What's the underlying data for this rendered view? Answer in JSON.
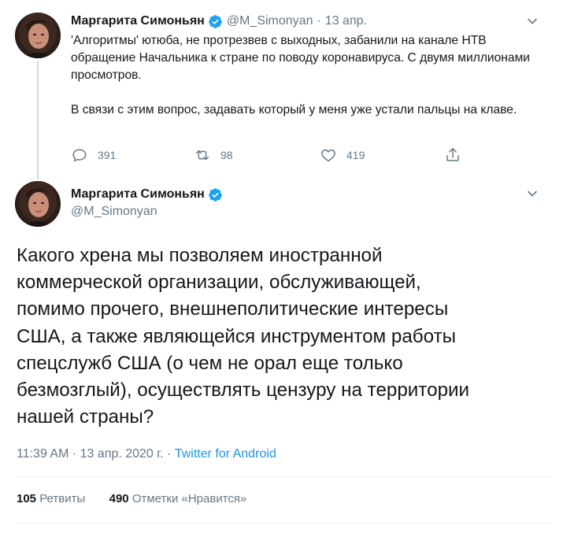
{
  "tweet1": {
    "name": "Маргарита Симоньян",
    "handle": "@M_Simonyan",
    "separator": "·",
    "date": "13 апр.",
    "paragraph1": "'Алгоритмы' ютюба, не протрезвев с выходных, забанили на канале НТВ обращение Начальника к стране по поводу коронавируса. С двумя миллионами просмотров.",
    "paragraph2": "В связи с этим вопрос, задавать который у меня уже устали пальцы на клаве.",
    "replies": "391",
    "retweets": "98",
    "likes": "419",
    "icons": [
      "reply-icon",
      "retweet-icon",
      "like-icon",
      "share-icon",
      "chevron-down-icon",
      "verified-badge-icon"
    ]
  },
  "tweet2": {
    "name": "Маргарита Симоньян",
    "handle": "@M_Simonyan",
    "text_lines": [
      "Какого хрена мы позволяем иностранной",
      "коммерческой организации, обслуживающей,",
      "помимо прочего, внешнеполитические интересы",
      "США, а также являющейся инструментом работы",
      "спецслужб США (о чем не орал еще только",
      "безмозглый), осуществлять цензуру на территории",
      "нашей страны?"
    ],
    "timestamp": "11:39 AM · 13 апр. 2020 г. · ",
    "source": "Twitter for Android",
    "retweet_count": "105",
    "retweet_label": "Ретвиты",
    "like_count": "490",
    "like_label": "Отметки «Нравится»"
  },
  "colors": {
    "text": "#14171a",
    "secondary": "#657786",
    "link": "#1b95e0",
    "verified": "#1da1f2",
    "divider": "#e6ecf0",
    "thread_line": "#ccd6dd"
  }
}
